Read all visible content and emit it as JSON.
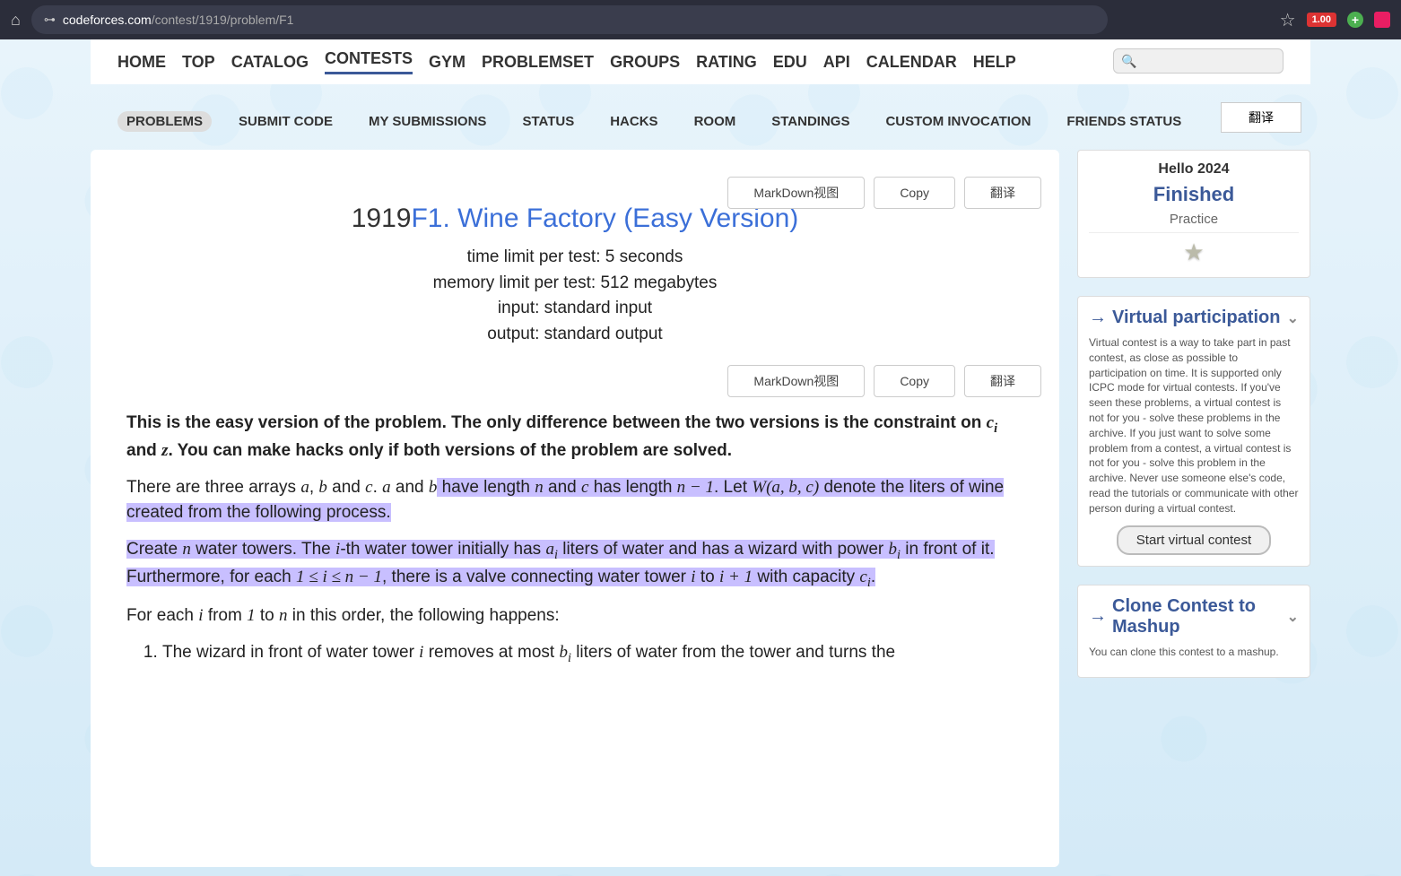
{
  "browser": {
    "url_domain": "codeforces.com",
    "url_path": "/contest/1919/problem/F1",
    "badge_ext": "1.00"
  },
  "main_nav": [
    "HOME",
    "TOP",
    "CATALOG",
    "CONTESTS",
    "GYM",
    "PROBLEMSET",
    "GROUPS",
    "RATING",
    "EDU",
    "API",
    "CALENDAR",
    "HELP"
  ],
  "main_nav_active": 3,
  "translate_top": "翻译",
  "sub_nav": [
    "PROBLEMS",
    "SUBMIT CODE",
    "MY SUBMISSIONS",
    "STATUS",
    "HACKS",
    "ROOM",
    "STANDINGS",
    "CUSTOM INVOCATION",
    "FRIENDS STATUS"
  ],
  "sub_nav_active": 0,
  "buttons": {
    "markdown": "MarkDown视图",
    "copy": "Copy",
    "translate": "翻译"
  },
  "problem": {
    "number": "1919",
    "title": "F1. Wine Factory (Easy Version)",
    "time_limit": "time limit per test: 5 seconds",
    "memory_limit": "memory limit per test: 512 megabytes",
    "input": "input: standard input",
    "output": "output: standard output",
    "intro_bold1": "This is the easy version of the problem. The only difference between the two versions is the constraint on ",
    "intro_bold2": " and ",
    "intro_bold3": ". You can make hacks only if both versions of the problem are solved.",
    "p2_1": "There are three arrays ",
    "p2_2": ", ",
    "p2_3": " and ",
    "p2_4": ". ",
    "p2_5": " and ",
    "p2_6": " have length ",
    "p2_hl1": " and ",
    "p2_hl2": " has length ",
    "p2_hl3": ". Let ",
    "p2_hl4": " denote the liters of wine created from the following process.",
    "p3_hl1": "Create ",
    "p3_hl2": " water towers. The ",
    "p3_hl3": "-th water tower initially has ",
    "p3_hl4": " liters of water and has a wizard with power ",
    "p3_hl5": " in front of it. Furthermore, for each ",
    "p3_hl6": ", there is a valve connecting water tower ",
    "p3_hl7": " to ",
    "p3_hl8": " with capacity ",
    "p3_hl9": ".",
    "p4_1": "For each ",
    "p4_2": " from ",
    "p4_3": " to ",
    "p4_4": " in this order, the following happens:",
    "li1_1": "The wizard in front of water tower ",
    "li1_2": " removes at most ",
    "li1_3": " liters of water from the tower and turns the"
  },
  "sidebar": {
    "contest_name": "Hello 2024",
    "status": "Finished",
    "practice": "Practice",
    "vp_header": "Virtual participation",
    "vp_text": "Virtual contest is a way to take part in past contest, as close as possible to participation on time. It is supported only ICPC mode for virtual contests. If you've seen these problems, a virtual contest is not for you - solve these problems in the archive. If you just want to solve some problem from a contest, a virtual contest is not for you - solve this problem in the archive. Never use someone else's code, read the tutorials or communicate with other person during a virtual contest.",
    "vp_button": "Start virtual contest",
    "clone_header": "Clone Contest to Mashup",
    "clone_text": "You can clone this contest to a mashup."
  }
}
